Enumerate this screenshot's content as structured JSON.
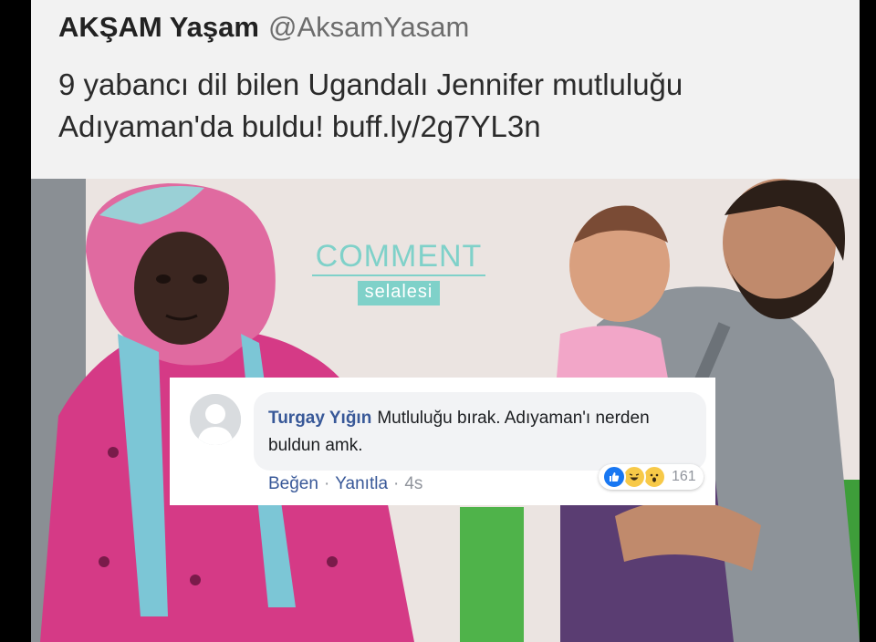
{
  "tweet": {
    "author_name": "AKŞAM Yaşam",
    "author_handle": "@AksamYasam",
    "text_line1": "9 yabancı dil bilen Ugandalı Jennifer mutluluğu",
    "text_line2": "Adıyaman'da buldu! buff.ly/2g7YL3n"
  },
  "watermark": {
    "title": "COMMENT",
    "subtitle": "selalesi",
    "color": "#7fd1c9"
  },
  "comment": {
    "author": "Turgay Yığın",
    "text": "Mutluluğu bırak. Adıyaman'ı nerden buldun amk.",
    "like_label": "Beğen",
    "separator": "·",
    "reply_label": "Yanıtla",
    "time": "4s",
    "reaction_icons": [
      "like-icon",
      "laugh-icon",
      "wow-icon"
    ],
    "reaction_count": "161",
    "link_color": "#385898"
  }
}
